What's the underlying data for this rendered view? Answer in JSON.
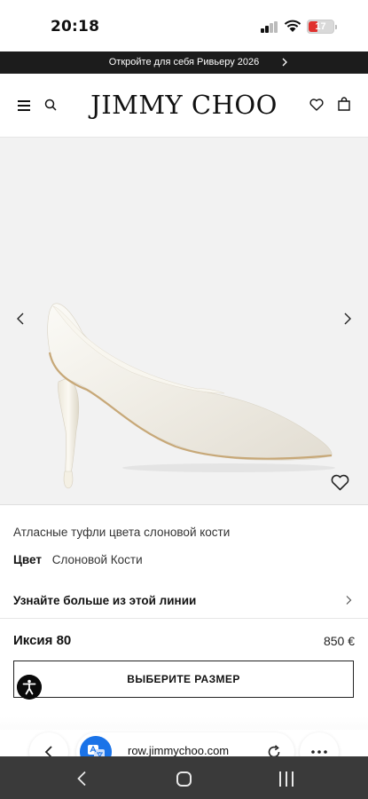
{
  "status_bar": {
    "time": "20:18",
    "battery_level": "17",
    "battery_color": "#e0312e"
  },
  "promo": {
    "text": "Откройте для себя Ривьеру 2026",
    "chevron_icon": "chevron-right-icon"
  },
  "header": {
    "logo": "JIMMY CHOO",
    "icons": [
      "menu-icon",
      "search-icon",
      "heart-icon",
      "shopping-bag-icon"
    ]
  },
  "gallery": {
    "prev_icon": "chevron-left-icon",
    "next_icon": "chevron-right-icon",
    "wishlist_icon": "heart-icon",
    "background": "#f2f2f2"
  },
  "product": {
    "description": "Атласные туфли цвета слоновой кости",
    "color_label": "Цвет",
    "color_value": "Слоновой Кости",
    "line_link": "Узнайте больше из этой линии",
    "name": "Иксия 80",
    "price": "850 €",
    "size_button": "ВЫБЕРИТЕ РАЗМЕР"
  },
  "browser": {
    "url": "row.jimmychoo.com",
    "icons": [
      "back-icon",
      "translate-icon",
      "reload-icon",
      "more-icon"
    ],
    "accent": "#1a73e8"
  },
  "nav_bar": {
    "icons": [
      "nav-back-icon",
      "nav-home-icon",
      "nav-recent-apps-icon"
    ]
  }
}
